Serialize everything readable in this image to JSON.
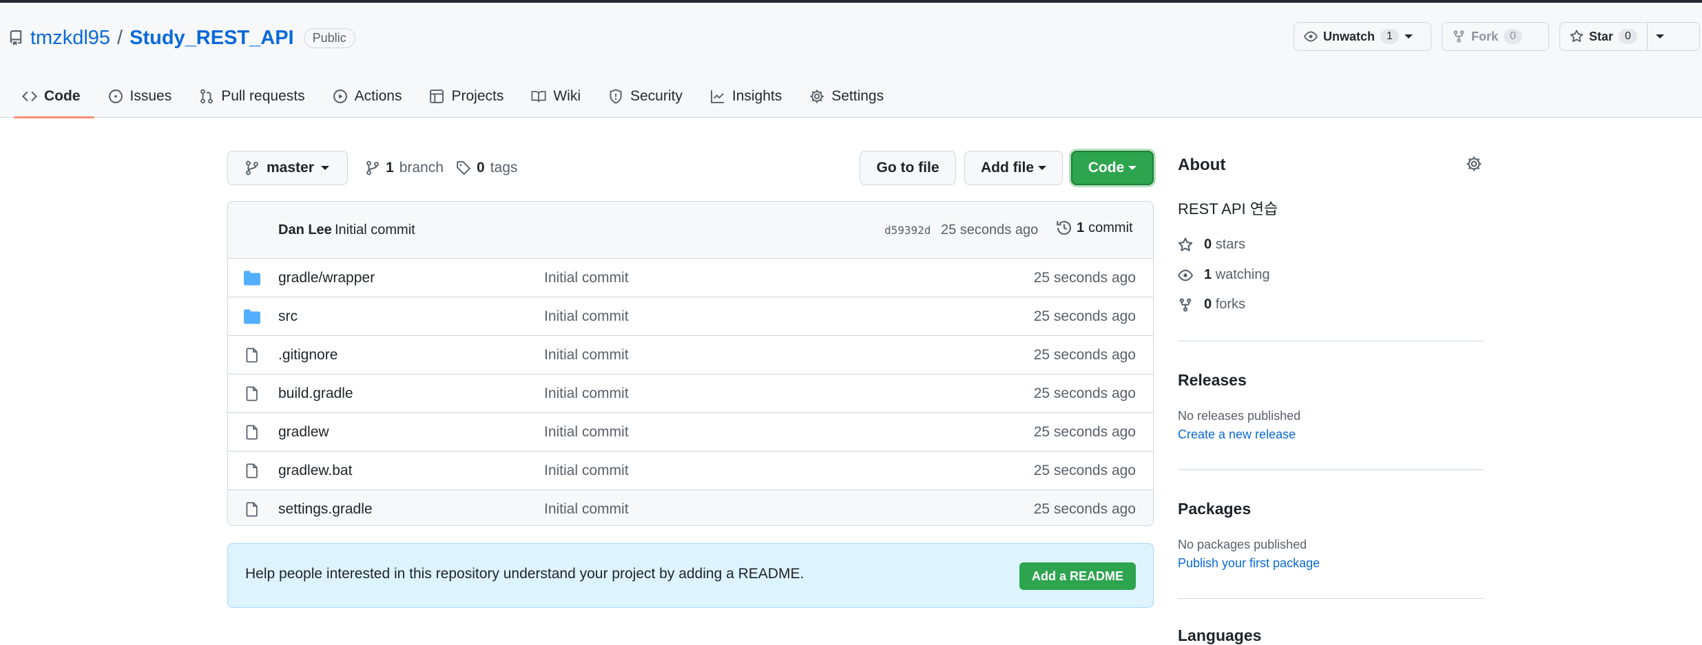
{
  "repo": {
    "owner": "tmzkdl95",
    "separator": "/",
    "name": "Study_REST_API",
    "visibility": "Public"
  },
  "actions": {
    "unwatch_label": "Unwatch",
    "watch_count": "1",
    "fork_label": "Fork",
    "fork_count": "0",
    "star_label": "Star",
    "star_count": "0"
  },
  "tabs": [
    {
      "label": "Code",
      "icon": "code-icon",
      "active": true
    },
    {
      "label": "Issues",
      "icon": "issue-icon"
    },
    {
      "label": "Pull requests",
      "icon": "pull-request-icon"
    },
    {
      "label": "Actions",
      "icon": "play-icon"
    },
    {
      "label": "Projects",
      "icon": "table-icon"
    },
    {
      "label": "Wiki",
      "icon": "book-icon"
    },
    {
      "label": "Security",
      "icon": "shield-icon"
    },
    {
      "label": "Insights",
      "icon": "graph-icon"
    },
    {
      "label": "Settings",
      "icon": "gear-icon"
    }
  ],
  "toolbar": {
    "branch": "master",
    "branch_count": "1",
    "branch_label": "branch",
    "tag_count": "0",
    "tag_label": "tags",
    "go_to_file": "Go to file",
    "add_file": "Add file",
    "code": "Code"
  },
  "latest_commit": {
    "author": "Dan Lee",
    "message": "Initial commit",
    "hash": "d59392d",
    "time": "25 seconds ago",
    "count": "1",
    "count_label": "commit"
  },
  "files": [
    {
      "name": "gradle/wrapper",
      "type": "dir",
      "commit": "Initial commit",
      "age": "25 seconds ago"
    },
    {
      "name": "src",
      "type": "dir",
      "commit": "Initial commit",
      "age": "25 seconds ago"
    },
    {
      "name": ".gitignore",
      "type": "file",
      "commit": "Initial commit",
      "age": "25 seconds ago"
    },
    {
      "name": "build.gradle",
      "type": "file",
      "commit": "Initial commit",
      "age": "25 seconds ago"
    },
    {
      "name": "gradlew",
      "type": "file",
      "commit": "Initial commit",
      "age": "25 seconds ago"
    },
    {
      "name": "gradlew.bat",
      "type": "file",
      "commit": "Initial commit",
      "age": "25 seconds ago"
    },
    {
      "name": "settings.gradle",
      "type": "file",
      "commit": "Initial commit",
      "age": "25 seconds ago"
    }
  ],
  "readme_banner": {
    "text": "Help people interested in this repository understand your project by adding a README.",
    "button": "Add a README"
  },
  "about": {
    "title": "About",
    "description": "REST API 연습",
    "stars_count": "0",
    "stars_label": "stars",
    "watching_count": "1",
    "watching_label": "watching",
    "forks_count": "0",
    "forks_label": "forks"
  },
  "releases": {
    "title": "Releases",
    "note": "No releases published",
    "link": "Create a new release"
  },
  "packages": {
    "title": "Packages",
    "note": "No packages published",
    "link": "Publish your first package"
  },
  "languages": {
    "title": "Languages"
  },
  "colors": {
    "accent_link": "#0969da",
    "primary_green": "#2da44e",
    "tab_underline": "#fd8c73",
    "folder_blue": "#54aeff"
  }
}
